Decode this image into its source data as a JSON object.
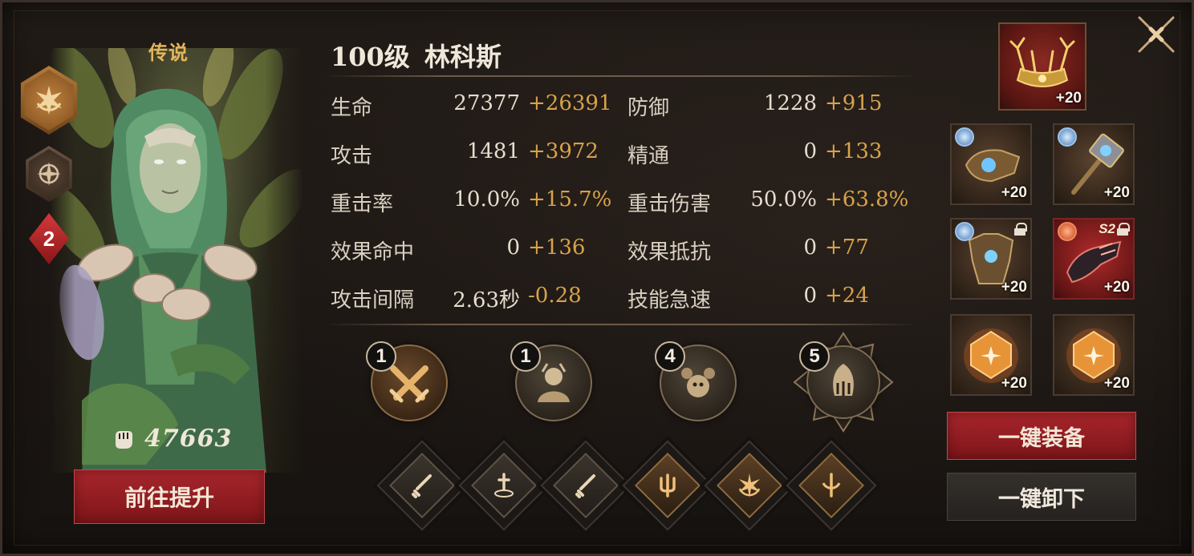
{
  "hero": {
    "rarity": "传说",
    "level_label": "100级",
    "name": "林科斯",
    "star_level": "2",
    "power": "47663",
    "upgrade_button": "前往提升"
  },
  "stats": {
    "left": [
      {
        "label": "生命",
        "base": "27377",
        "bonus": "+26391"
      },
      {
        "label": "攻击",
        "base": "1481",
        "bonus": "+3972"
      },
      {
        "label": "重击率",
        "base": "10.0%",
        "bonus": "+15.7%"
      },
      {
        "label": "效果命中",
        "base": "0",
        "bonus": "+136"
      },
      {
        "label": "攻击间隔",
        "base": "2.63秒",
        "bonus": "-0.28"
      }
    ],
    "right": [
      {
        "label": "防御",
        "base": "1228",
        "bonus": "+915"
      },
      {
        "label": "精通",
        "base": "0",
        "bonus": "+133"
      },
      {
        "label": "重击伤害",
        "base": "50.0%",
        "bonus": "+63.8%"
      },
      {
        "label": "效果抵抗",
        "base": "0",
        "bonus": "+77"
      },
      {
        "label": "技能急速",
        "base": "0",
        "bonus": "+24"
      }
    ]
  },
  "skills": [
    {
      "level": "1",
      "icon": "crossed-swords-icon"
    },
    {
      "level": "1",
      "icon": "hero-portrait-icon"
    },
    {
      "level": "4",
      "icon": "beast-icon"
    },
    {
      "level": "5",
      "icon": "ultimate-emblem-icon"
    }
  ],
  "passives": [
    {
      "icon": "sword-icon"
    },
    {
      "icon": "dagger-icon"
    },
    {
      "icon": "sword-icon"
    },
    {
      "icon": "trident-icon"
    },
    {
      "icon": "sun-icon"
    },
    {
      "icon": "moon-sword-icon"
    }
  ],
  "equipment": [
    {
      "slot": "crown",
      "level": "+20"
    },
    {
      "slot": "glove",
      "level": "+20"
    },
    {
      "slot": "hammer",
      "level": "+20"
    },
    {
      "slot": "armor",
      "level": "+20"
    },
    {
      "slot": "gauntlet",
      "level": "+20",
      "season": "S2"
    },
    {
      "slot": "gem",
      "level": "+20"
    },
    {
      "slot": "gem",
      "level": "+20"
    }
  ],
  "buttons": {
    "equip_all": "一键装备",
    "unequip_all": "一键卸下"
  },
  "colors": {
    "accent_gold": "#d8a24a",
    "button_red": "#a8262c",
    "rarity_gold": "#e4b55a"
  }
}
